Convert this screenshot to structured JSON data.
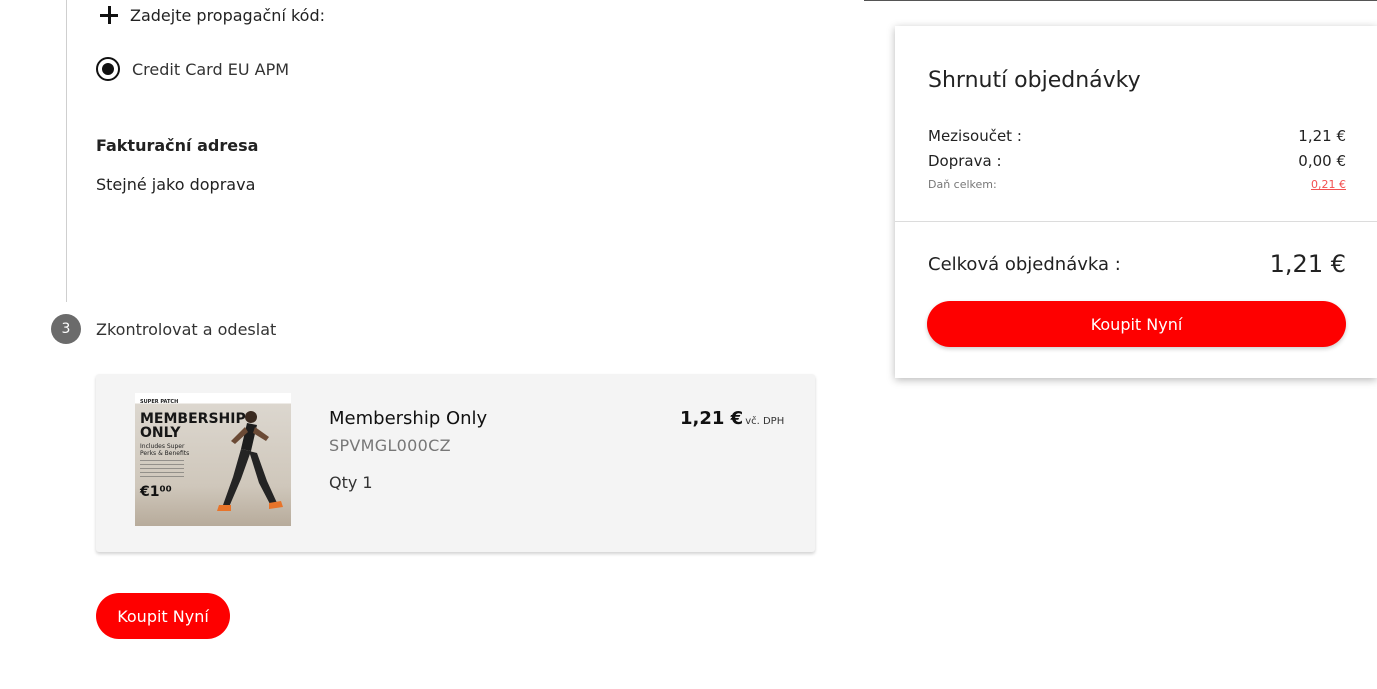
{
  "checkout": {
    "promo_label": "Zadejte propagační kód:",
    "payment_method": "Credit Card EU APM",
    "billing_heading": "Fakturační adresa",
    "billing_value": "Stejné jako doprava",
    "step_number": "3",
    "step_title": "Zkontrolovat a odeslat",
    "buy_button": "Koupit Nyní"
  },
  "product": {
    "image": {
      "brand": "SUPER PATCH",
      "title_line1": "MEMBERSHIP",
      "title_line2": "ONLY",
      "subtitle": "Includes Super Perks & Benefits",
      "price": "€1⁰⁰"
    },
    "name": "Membership Only",
    "sku": "SPVMGL000CZ",
    "qty": "Qty 1",
    "price": "1,21 €",
    "tax_note": "vč. DPH"
  },
  "summary": {
    "title": "Shrnutí objednávky",
    "subtotal_label": "Mezisoučet :",
    "subtotal_value": "1,21 €",
    "shipping_label": "Doprava :",
    "shipping_value": "0,00 €",
    "tax_label": "Daň celkem:",
    "tax_value": "0,21 €",
    "total_label": "Celková objednávka :",
    "total_value": "1,21 €",
    "buy_button": "Koupit Nyní"
  },
  "colors": {
    "accent": "#fe0000",
    "tax_link": "#f35050",
    "step_badge": "#6b6b6b"
  }
}
